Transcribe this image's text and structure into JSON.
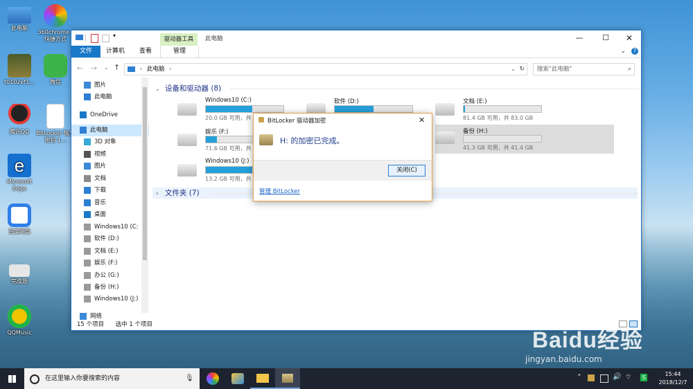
{
  "desktop": {
    "icons": [
      {
        "label": "此电脑",
        "color": "#4a90d9"
      },
      {
        "label": "360chrome - 快捷方式",
        "color": "#f4a321"
      },
      {
        "label": "t0102ef1...",
        "color": "#7a6d3a"
      },
      {
        "label": "微信",
        "color": "#3db34a"
      },
      {
        "label": "腾讯QQ",
        "color": "#222222"
      },
      {
        "label": "BitLocker 恢复密钥 1...",
        "color": "#ffffff"
      },
      {
        "label": "Microsoft Edge",
        "color": "#1570cf"
      },
      {
        "label": "百度网盘",
        "color": "#2f7fe8"
      },
      {
        "label": "完成题",
        "color": "#e6e6e6"
      },
      {
        "label": "QQMusic",
        "color": "#f2c400"
      }
    ]
  },
  "explorer": {
    "title": "此电脑",
    "context_header": "驱动器工具",
    "tabs": [
      "文件",
      "计算机",
      "查看"
    ],
    "context_tab": "管理",
    "address": "此电脑",
    "address_sep": "›",
    "search_placeholder": "搜索\"此电脑\"",
    "nav": [
      {
        "label": "图片",
        "icon": "pictures-icon"
      },
      {
        "label": "此电脑",
        "icon": "this-pc-icon"
      },
      {
        "label": "OneDrive",
        "icon": "onedrive-icon"
      },
      {
        "label": "此电脑",
        "icon": "this-pc-icon"
      },
      {
        "label": "3D 对象",
        "icon": "3d-objects-icon"
      },
      {
        "label": "视频",
        "icon": "videos-icon"
      },
      {
        "label": "图片",
        "icon": "pictures-icon"
      },
      {
        "label": "文档",
        "icon": "documents-icon"
      },
      {
        "label": "下载",
        "icon": "downloads-icon"
      },
      {
        "label": "音乐",
        "icon": "music-icon"
      },
      {
        "label": "桌面",
        "icon": "desktop-icon"
      },
      {
        "label": "Windows10 (C:",
        "icon": "drive-icon"
      },
      {
        "label": "软件 (D:)",
        "icon": "drive-icon"
      },
      {
        "label": "文档 (E:)",
        "icon": "drive-icon"
      },
      {
        "label": "娱乐 (F:)",
        "icon": "drive-icon"
      },
      {
        "label": "办公 (G:)",
        "icon": "drive-icon"
      },
      {
        "label": "备份 (H:)",
        "icon": "drive-icon"
      },
      {
        "label": "Windows10 (J:)",
        "icon": "drive-icon"
      },
      {
        "label": "网络",
        "icon": "network-icon"
      }
    ],
    "devices_header": "设备和驱动器 (8)",
    "folders_header": "文件夹 (7)",
    "drives": [
      {
        "name": "Windows10 (C:)",
        "info": "20.0 GB 可用，共",
        "used_fraction": 0.6
      },
      {
        "name": "软件 (D:)",
        "info": "",
        "used_fraction": 0.5
      },
      {
        "name": "文档 (E:)",
        "info": "81.4 GB 可用，共 83.0 GB",
        "used_fraction": 0.02
      },
      {
        "name": "娱乐 (F:)",
        "info": "71.6 GB 可用，共",
        "used_fraction": 0.14
      },
      {
        "name": "备份 (H:)",
        "info": "41.3 GB 可用，共 41.4 GB",
        "used_fraction": 0.0
      },
      {
        "name": "Windows10 (J:)",
        "info": "13.2 GB 可用，共",
        "used_fraction": 0.6
      }
    ],
    "status_items": "15 个项目",
    "status_selected": "选中 1 个项目"
  },
  "dialog": {
    "title": "BitLocker 驱动器加密",
    "message": "H: 的加密已完成。",
    "close_label": "关闭(C)",
    "manage_link": "管理 BitLocker"
  },
  "taskbar": {
    "search_placeholder": "在这里输入你要搜索的内容",
    "time": "15:44",
    "date": "2018/12/7"
  },
  "watermark": {
    "brand": "Baidu经验",
    "url": "jingyan.baidu.com"
  },
  "colors": {
    "accent": "#1a78c8",
    "drive_bar": "#26a0da",
    "context_green": "#d8f0c4",
    "taskbar": "#1d2430"
  }
}
